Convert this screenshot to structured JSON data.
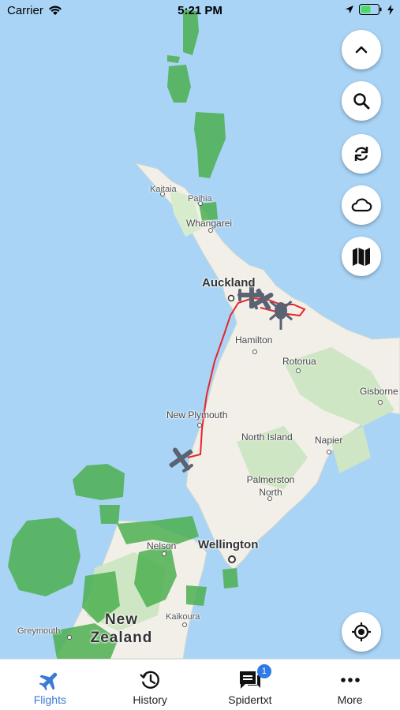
{
  "status_bar": {
    "carrier": "Carrier",
    "time": "5:21 PM"
  },
  "map": {
    "labels": {
      "kaitaia": "Kaitaia",
      "paihia": "Paihia",
      "whangarei": "Whangarei",
      "auckland": "Auckland",
      "hamilton": "Hamilton",
      "rotorua": "Rotorua",
      "gisborne": "Gisborne",
      "new_plymouth": "New Plymouth",
      "north_island": "North Island",
      "napier": "Napier",
      "palmerston_north": "Palmerston North",
      "nelson": "Nelson",
      "wellington": "Wellington",
      "kaikoura": "Kaikoura",
      "greymouth": "Greymouth",
      "new_zealand": "New Zealand"
    },
    "colors": {
      "water": "#a9d4f6",
      "land": "#f2efe9",
      "forest": "#cfe6c4",
      "rain": "#4caf50",
      "flight_path": "#e8262a",
      "aircraft": "#5b6272"
    }
  },
  "controls": {
    "collapse": "chevron-up-icon",
    "search": "search-icon",
    "refresh": "refresh-icon",
    "weather": "cloud-icon",
    "map_type": "map-icon",
    "locate": "locate-icon"
  },
  "tab_bar": {
    "tabs": [
      {
        "label": "Flights",
        "icon": "plane-icon",
        "active": true
      },
      {
        "label": "History",
        "icon": "history-icon",
        "active": false
      },
      {
        "label": "Spidertxt",
        "icon": "chat-icon",
        "active": false,
        "badge": "1"
      },
      {
        "label": "More",
        "icon": "more-icon",
        "active": false
      }
    ]
  }
}
